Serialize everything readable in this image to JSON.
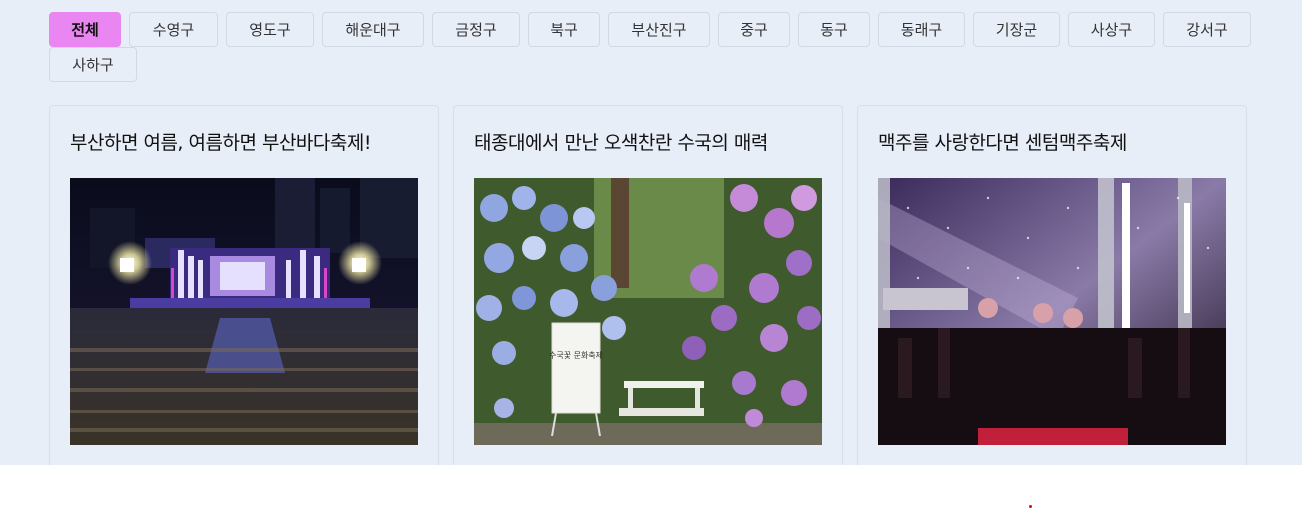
{
  "filters": [
    {
      "label": "전체",
      "active": true
    },
    {
      "label": "수영구"
    },
    {
      "label": "영도구"
    },
    {
      "label": "해운대구"
    },
    {
      "label": "금정구"
    },
    {
      "label": "북구"
    },
    {
      "label": "부산진구"
    },
    {
      "label": "중구"
    },
    {
      "label": "동구"
    },
    {
      "label": "동래구"
    },
    {
      "label": "기장군"
    },
    {
      "label": "사상구"
    },
    {
      "label": "강서구"
    },
    {
      "label": "사하구"
    }
  ],
  "cards": [
    {
      "title": "부산하면 여름, 여름하면 부산바다축제!"
    },
    {
      "title": "태종대에서 만난 오색찬란 수국의 매력",
      "sign_text": "수국꽃 문화축제"
    },
    {
      "title": "맥주를 사랑한다면 센텀맥주축제"
    }
  ],
  "colors": {
    "active_chip": "#e986f2",
    "panel_bg": "#e8eef7"
  }
}
